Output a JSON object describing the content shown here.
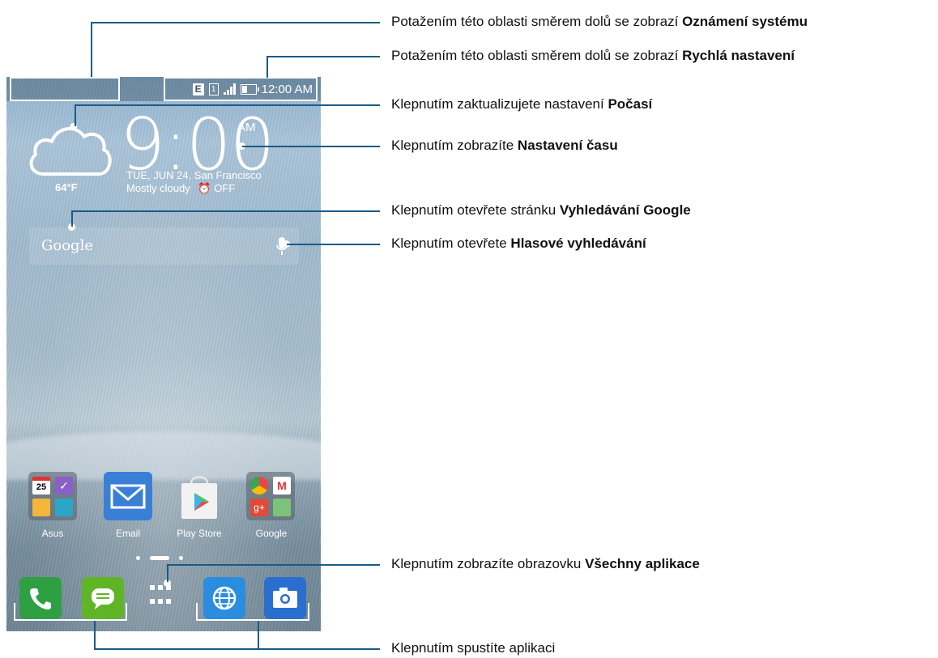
{
  "status_bar": {
    "network": "E",
    "sim": "1",
    "time": "12:00 AM"
  },
  "weather": {
    "temperature": "64°F",
    "condition": "Mostly cloudy",
    "alarm": "OFF"
  },
  "clock": {
    "time": "9:00",
    "ampm": "AM",
    "date_location": "TUE, JUN 24, San Francisco"
  },
  "search": {
    "label": "Google"
  },
  "apps": [
    {
      "label": "Asus"
    },
    {
      "label": "Email"
    },
    {
      "label": "Play Store"
    },
    {
      "label": "Google"
    }
  ],
  "calendar_date": "25",
  "callouts": {
    "notifications": {
      "prefix": "Potažením této oblasti směrem dolů se zobrazí ",
      "bold": "Oznámení systému"
    },
    "quick_settings": {
      "prefix": "Potažením této oblasti směrem dolů se zobrazí ",
      "bold": "Rychlá nastavení"
    },
    "weather": {
      "prefix": "Klepnutím zaktualizujete nastavení ",
      "bold": "Počasí"
    },
    "time": {
      "prefix": "Klepnutím zobrazíte ",
      "bold": "Nastavení času"
    },
    "google_search": {
      "prefix": "Klepnutím otevřete stránku ",
      "bold": "Vyhledávání Google"
    },
    "voice_search": {
      "prefix": "Klepnutím otevřete ",
      "bold": "Hlasové vyhledávání"
    },
    "all_apps": {
      "prefix": "Klepnutím zobrazíte obrazovku ",
      "bold": "Všechny aplikace"
    },
    "launch_app": {
      "prefix": "Klepnutím spustíte aplikaci",
      "bold": ""
    }
  },
  "colors": {
    "callout_line": "#1c5a86",
    "phone": "#2ea043",
    "messages": "#5fb526",
    "browser": "#2a8de0",
    "camera": "#2a6fd0",
    "email": "#3a7fd6"
  }
}
